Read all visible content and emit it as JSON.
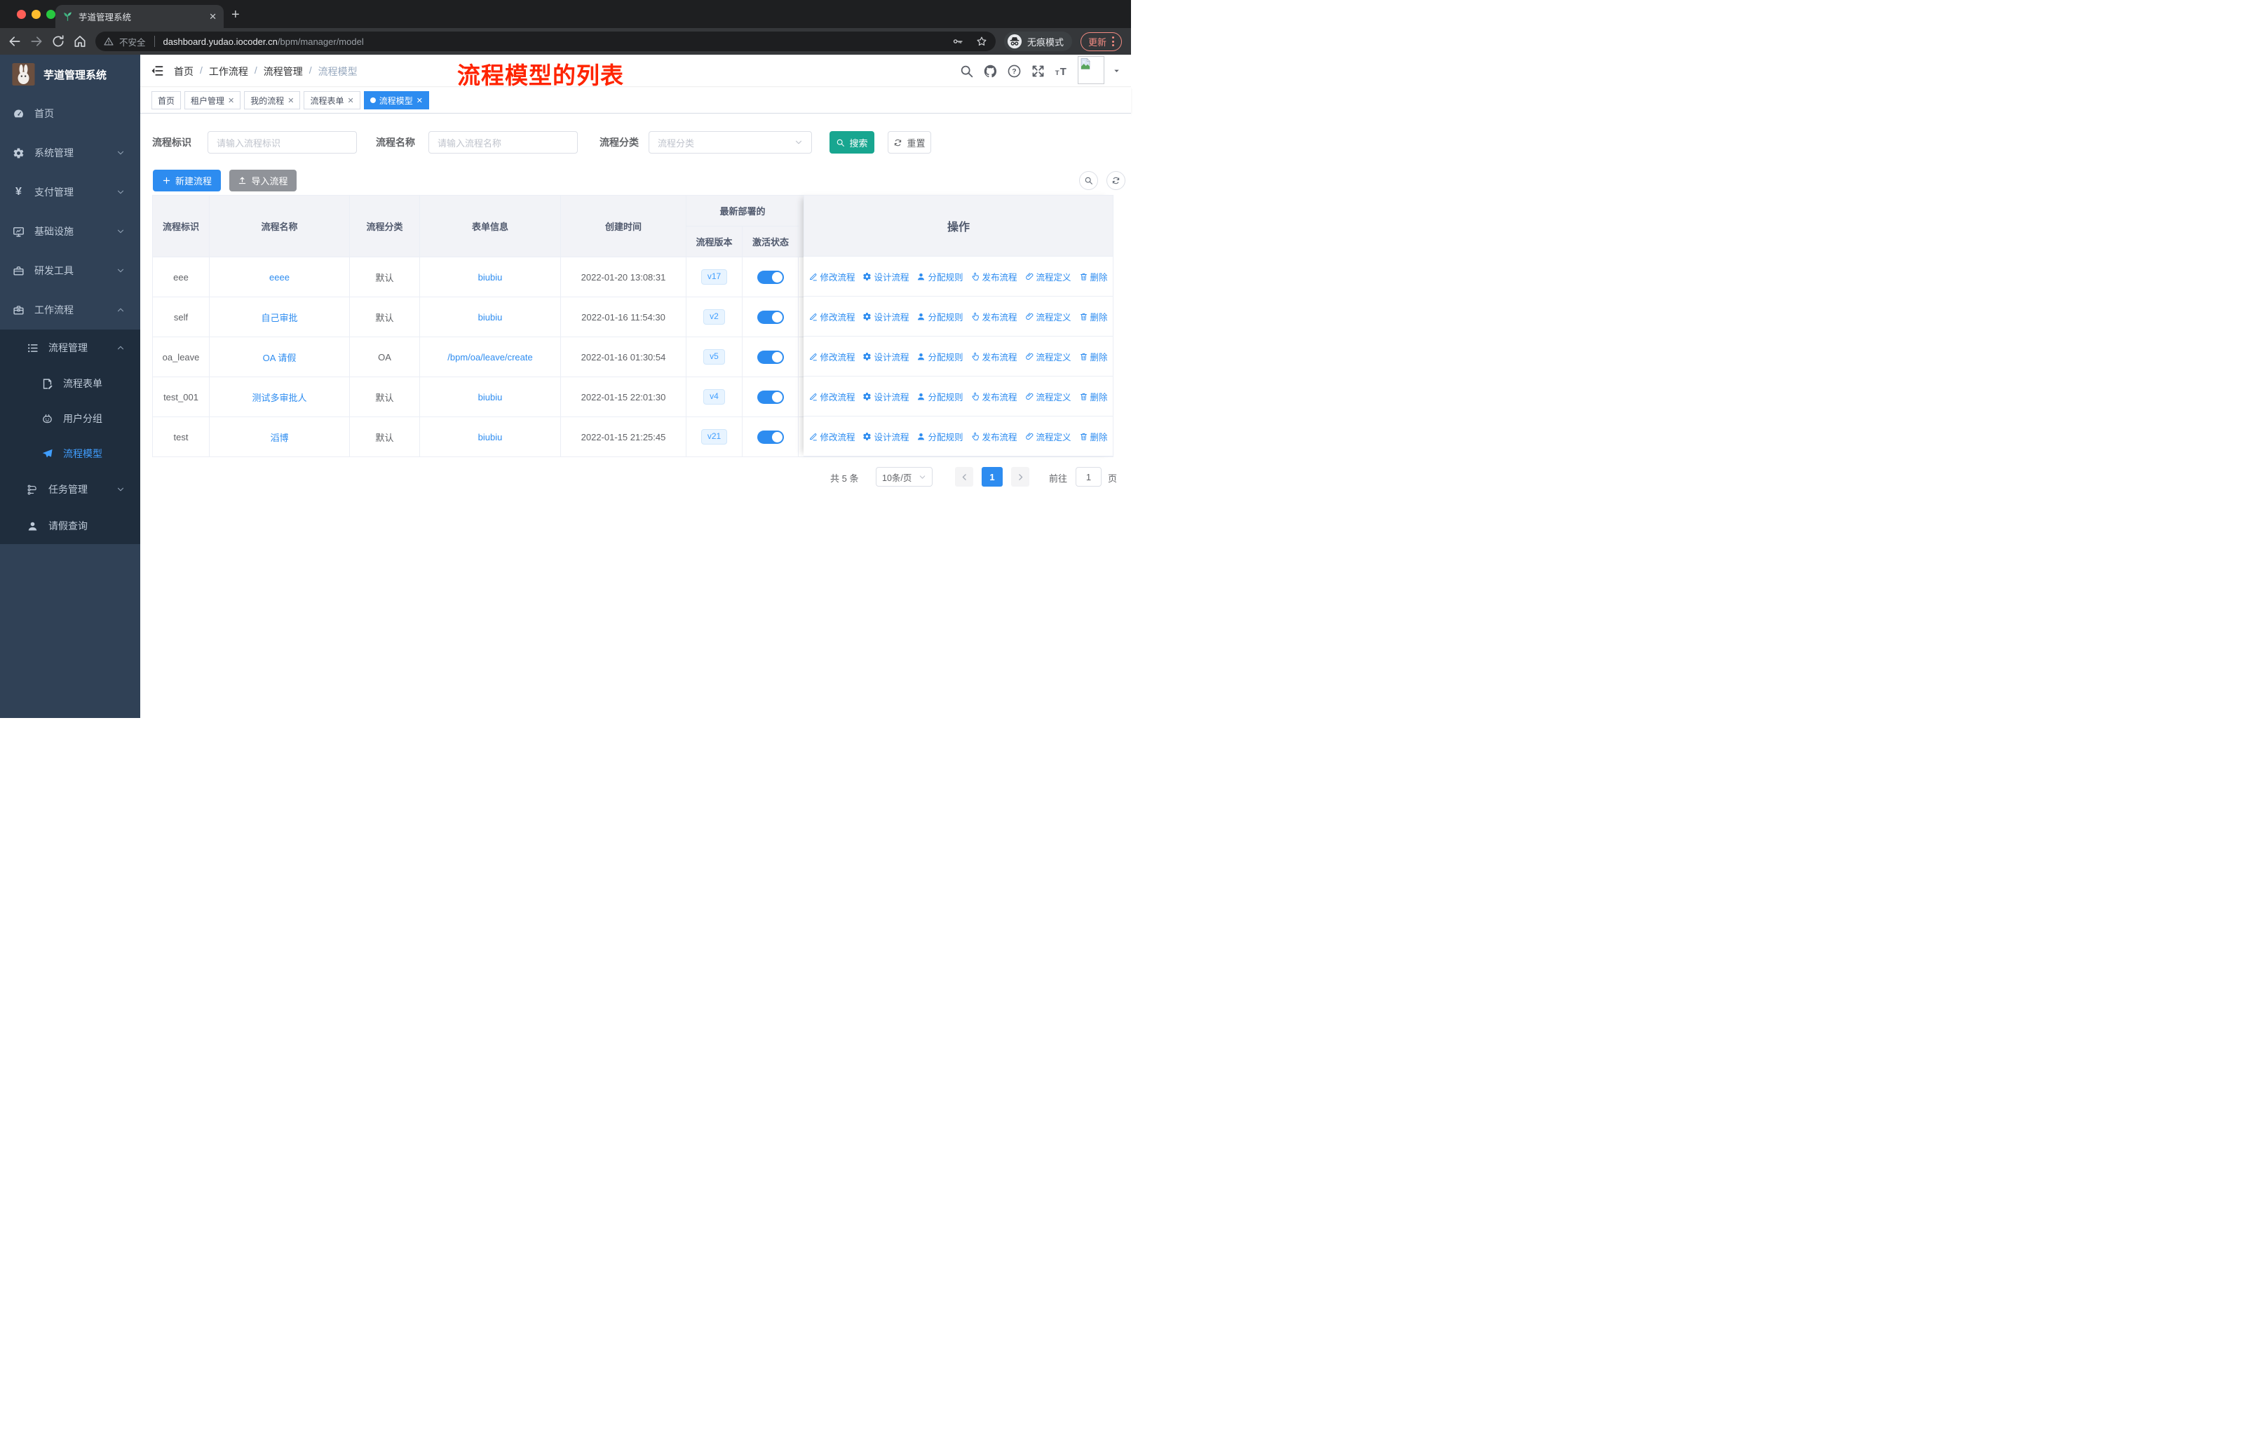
{
  "browser": {
    "tab_title": "芋道管理系统",
    "security_label": "不安全",
    "url_domain": "dashboard.yudao.iocoder.cn",
    "url_path": "/bpm/manager/model",
    "incognito_label": "无痕模式",
    "update_label": "更新"
  },
  "sidebar": {
    "title": "芋道管理系统",
    "items": [
      {
        "label": "首页",
        "icon": "dashboard-icon",
        "arrow": ""
      },
      {
        "label": "系统管理",
        "icon": "gear-icon",
        "arrow": "down"
      },
      {
        "label": "支付管理",
        "icon": "yen-icon",
        "arrow": "down"
      },
      {
        "label": "基础设施",
        "icon": "monitor-icon",
        "arrow": "down"
      },
      {
        "label": "研发工具",
        "icon": "toolbox-icon",
        "arrow": "down"
      },
      {
        "label": "工作流程",
        "icon": "briefcase-icon",
        "arrow": "up"
      }
    ],
    "submenu": [
      {
        "label": "流程管理",
        "icon": "list-icon",
        "arrow": "up",
        "level": 1,
        "active": false
      },
      {
        "label": "流程表单",
        "icon": "form-icon",
        "arrow": "",
        "level": 2,
        "active": false
      },
      {
        "label": "用户分组",
        "icon": "robot-icon",
        "arrow": "",
        "level": 2,
        "active": false
      },
      {
        "label": "流程模型",
        "icon": "send-icon",
        "arrow": "",
        "level": 2,
        "active": true
      },
      {
        "label": "任务管理",
        "icon": "tasks-icon",
        "arrow": "down",
        "level": 1,
        "active": false
      },
      {
        "label": "请假查询",
        "icon": "user-icon",
        "arrow": "",
        "level": 1,
        "active": false
      }
    ]
  },
  "header": {
    "breadcrumb": [
      "首页",
      "工作流程",
      "流程管理",
      "流程模型"
    ],
    "annotation": "流程模型的列表"
  },
  "tags": [
    {
      "label": "首页",
      "closable": false,
      "active": false
    },
    {
      "label": "租户管理",
      "closable": true,
      "active": false
    },
    {
      "label": "我的流程",
      "closable": true,
      "active": false
    },
    {
      "label": "流程表单",
      "closable": true,
      "active": false
    },
    {
      "label": "流程模型",
      "closable": true,
      "active": true
    }
  ],
  "filters": {
    "fields": [
      {
        "label": "流程标识",
        "placeholder": "请输入流程标识",
        "type": "input"
      },
      {
        "label": "流程名称",
        "placeholder": "请输入流程名称",
        "type": "input"
      },
      {
        "label": "流程分类",
        "placeholder": "流程分类",
        "type": "select"
      }
    ],
    "search_label": "搜索",
    "reset_label": "重置"
  },
  "toolbar": {
    "create_label": "新建流程",
    "import_label": "导入流程"
  },
  "table": {
    "columns": [
      "流程标识",
      "流程名称",
      "流程分类",
      "表单信息",
      "创建时间"
    ],
    "group_header": "最新部署的",
    "sub_columns": [
      "流程版本",
      "激活状态"
    ],
    "actions_header": "操作",
    "actions": [
      {
        "label": "修改流程",
        "icon": "edit-icon"
      },
      {
        "label": "设计流程",
        "icon": "design-icon"
      },
      {
        "label": "分配规则",
        "icon": "assign-icon"
      },
      {
        "label": "发布流程",
        "icon": "publish-icon"
      },
      {
        "label": "流程定义",
        "icon": "definition-icon"
      },
      {
        "label": "删除",
        "icon": "delete-icon"
      }
    ],
    "rows": [
      {
        "id": "eee",
        "name": "eeee",
        "category": "默认",
        "form": "biubiu",
        "created": "2022-01-20 13:08:31",
        "version": "v17",
        "active": true
      },
      {
        "id": "self",
        "name": "自己审批",
        "category": "默认",
        "form": "biubiu",
        "created": "2022-01-16 11:54:30",
        "version": "v2",
        "active": true
      },
      {
        "id": "oa_leave",
        "name": "OA 请假",
        "category": "OA",
        "form": "/bpm/oa/leave/create",
        "created": "2022-01-16 01:30:54",
        "version": "v5",
        "active": true
      },
      {
        "id": "test_001",
        "name": "测试多审批人",
        "category": "默认",
        "form": "biubiu",
        "created": "2022-01-15 22:01:30",
        "version": "v4",
        "active": true
      },
      {
        "id": "test",
        "name": "滔博",
        "category": "默认",
        "form": "biubiu",
        "created": "2022-01-15 21:25:45",
        "version": "v21",
        "active": true
      }
    ]
  },
  "pagination": {
    "total": "共 5 条",
    "page_size": "10条/页",
    "current": "1",
    "goto": "前往",
    "page_unit": "页"
  }
}
